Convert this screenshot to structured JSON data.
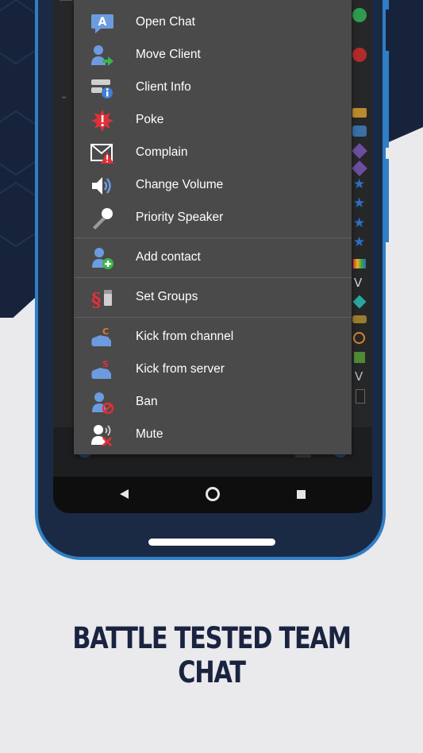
{
  "menu": {
    "items": [
      {
        "label": "Open Chat",
        "icon": "chat-bubble-icon"
      },
      {
        "label": "Move Client",
        "icon": "move-client-icon"
      },
      {
        "label": "Client Info",
        "icon": "client-info-icon"
      },
      {
        "label": "Poke",
        "icon": "poke-icon"
      },
      {
        "label": "Complain",
        "icon": "complain-icon"
      },
      {
        "label": "Change Volume",
        "icon": "volume-icon"
      },
      {
        "label": "Priority Speaker",
        "icon": "microphone-icon"
      },
      {
        "label": "Add contact",
        "icon": "add-contact-icon"
      },
      {
        "label": "Set Groups",
        "icon": "set-groups-icon"
      },
      {
        "label": "Kick from channel",
        "icon": "kick-channel-icon"
      },
      {
        "label": "Kick from server",
        "icon": "kick-server-icon"
      },
      {
        "label": "Ban",
        "icon": "ban-icon"
      },
      {
        "label": "Mute",
        "icon": "mute-icon"
      }
    ]
  },
  "navigation": {
    "back": "back-icon",
    "home": "home-icon",
    "recents": "recents-icon"
  },
  "tagline": "BATTLE TESTED TEAM CHAT",
  "colors": {
    "accent": "#2f7fc6",
    "phone_body": "#1b2a44",
    "menu_bg": "#4a4a4a",
    "tagline": "#1a2440",
    "page_bg": "#eae9ec"
  }
}
